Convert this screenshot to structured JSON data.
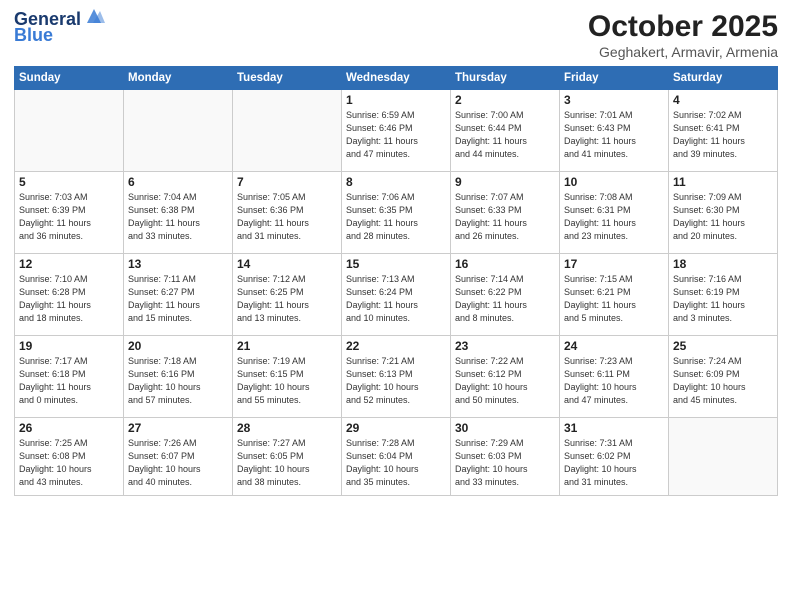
{
  "header": {
    "logo_line1": "General",
    "logo_line2": "Blue",
    "month_title": "October 2025",
    "location": "Geghakert, Armavir, Armenia"
  },
  "weekdays": [
    "Sunday",
    "Monday",
    "Tuesday",
    "Wednesday",
    "Thursday",
    "Friday",
    "Saturday"
  ],
  "weeks": [
    [
      {
        "day": "",
        "info": ""
      },
      {
        "day": "",
        "info": ""
      },
      {
        "day": "",
        "info": ""
      },
      {
        "day": "1",
        "info": "Sunrise: 6:59 AM\nSunset: 6:46 PM\nDaylight: 11 hours\nand 47 minutes."
      },
      {
        "day": "2",
        "info": "Sunrise: 7:00 AM\nSunset: 6:44 PM\nDaylight: 11 hours\nand 44 minutes."
      },
      {
        "day": "3",
        "info": "Sunrise: 7:01 AM\nSunset: 6:43 PM\nDaylight: 11 hours\nand 41 minutes."
      },
      {
        "day": "4",
        "info": "Sunrise: 7:02 AM\nSunset: 6:41 PM\nDaylight: 11 hours\nand 39 minutes."
      }
    ],
    [
      {
        "day": "5",
        "info": "Sunrise: 7:03 AM\nSunset: 6:39 PM\nDaylight: 11 hours\nand 36 minutes."
      },
      {
        "day": "6",
        "info": "Sunrise: 7:04 AM\nSunset: 6:38 PM\nDaylight: 11 hours\nand 33 minutes."
      },
      {
        "day": "7",
        "info": "Sunrise: 7:05 AM\nSunset: 6:36 PM\nDaylight: 11 hours\nand 31 minutes."
      },
      {
        "day": "8",
        "info": "Sunrise: 7:06 AM\nSunset: 6:35 PM\nDaylight: 11 hours\nand 28 minutes."
      },
      {
        "day": "9",
        "info": "Sunrise: 7:07 AM\nSunset: 6:33 PM\nDaylight: 11 hours\nand 26 minutes."
      },
      {
        "day": "10",
        "info": "Sunrise: 7:08 AM\nSunset: 6:31 PM\nDaylight: 11 hours\nand 23 minutes."
      },
      {
        "day": "11",
        "info": "Sunrise: 7:09 AM\nSunset: 6:30 PM\nDaylight: 11 hours\nand 20 minutes."
      }
    ],
    [
      {
        "day": "12",
        "info": "Sunrise: 7:10 AM\nSunset: 6:28 PM\nDaylight: 11 hours\nand 18 minutes."
      },
      {
        "day": "13",
        "info": "Sunrise: 7:11 AM\nSunset: 6:27 PM\nDaylight: 11 hours\nand 15 minutes."
      },
      {
        "day": "14",
        "info": "Sunrise: 7:12 AM\nSunset: 6:25 PM\nDaylight: 11 hours\nand 13 minutes."
      },
      {
        "day": "15",
        "info": "Sunrise: 7:13 AM\nSunset: 6:24 PM\nDaylight: 11 hours\nand 10 minutes."
      },
      {
        "day": "16",
        "info": "Sunrise: 7:14 AM\nSunset: 6:22 PM\nDaylight: 11 hours\nand 8 minutes."
      },
      {
        "day": "17",
        "info": "Sunrise: 7:15 AM\nSunset: 6:21 PM\nDaylight: 11 hours\nand 5 minutes."
      },
      {
        "day": "18",
        "info": "Sunrise: 7:16 AM\nSunset: 6:19 PM\nDaylight: 11 hours\nand 3 minutes."
      }
    ],
    [
      {
        "day": "19",
        "info": "Sunrise: 7:17 AM\nSunset: 6:18 PM\nDaylight: 11 hours\nand 0 minutes."
      },
      {
        "day": "20",
        "info": "Sunrise: 7:18 AM\nSunset: 6:16 PM\nDaylight: 10 hours\nand 57 minutes."
      },
      {
        "day": "21",
        "info": "Sunrise: 7:19 AM\nSunset: 6:15 PM\nDaylight: 10 hours\nand 55 minutes."
      },
      {
        "day": "22",
        "info": "Sunrise: 7:21 AM\nSunset: 6:13 PM\nDaylight: 10 hours\nand 52 minutes."
      },
      {
        "day": "23",
        "info": "Sunrise: 7:22 AM\nSunset: 6:12 PM\nDaylight: 10 hours\nand 50 minutes."
      },
      {
        "day": "24",
        "info": "Sunrise: 7:23 AM\nSunset: 6:11 PM\nDaylight: 10 hours\nand 47 minutes."
      },
      {
        "day": "25",
        "info": "Sunrise: 7:24 AM\nSunset: 6:09 PM\nDaylight: 10 hours\nand 45 minutes."
      }
    ],
    [
      {
        "day": "26",
        "info": "Sunrise: 7:25 AM\nSunset: 6:08 PM\nDaylight: 10 hours\nand 43 minutes."
      },
      {
        "day": "27",
        "info": "Sunrise: 7:26 AM\nSunset: 6:07 PM\nDaylight: 10 hours\nand 40 minutes."
      },
      {
        "day": "28",
        "info": "Sunrise: 7:27 AM\nSunset: 6:05 PM\nDaylight: 10 hours\nand 38 minutes."
      },
      {
        "day": "29",
        "info": "Sunrise: 7:28 AM\nSunset: 6:04 PM\nDaylight: 10 hours\nand 35 minutes."
      },
      {
        "day": "30",
        "info": "Sunrise: 7:29 AM\nSunset: 6:03 PM\nDaylight: 10 hours\nand 33 minutes."
      },
      {
        "day": "31",
        "info": "Sunrise: 7:31 AM\nSunset: 6:02 PM\nDaylight: 10 hours\nand 31 minutes."
      },
      {
        "day": "",
        "info": ""
      }
    ]
  ]
}
